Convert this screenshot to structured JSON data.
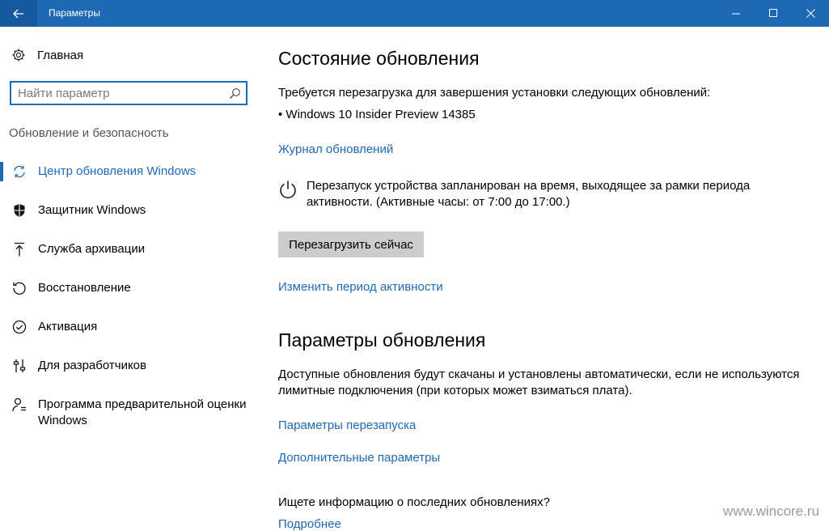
{
  "window": {
    "title": "Параметры",
    "controls": {
      "back": "back-arrow-icon",
      "minimize": "minimize-icon",
      "maximize": "maximize-icon",
      "close": "close-icon"
    },
    "accent_color": "#1e69b4"
  },
  "sidebar": {
    "home_label": "Главная",
    "search_placeholder": "Найти параметр",
    "section_title": "Обновление и безопасность",
    "items": [
      {
        "label": "Центр обновления Windows",
        "icon": "sync-icon",
        "active": true
      },
      {
        "label": "Защитник Windows",
        "icon": "shield-icon"
      },
      {
        "label": "Служба архивации",
        "icon": "backup-arrow-icon"
      },
      {
        "label": "Восстановление",
        "icon": "history-icon"
      },
      {
        "label": "Активация",
        "icon": "check-circle-icon"
      },
      {
        "label": "Для разработчиков",
        "icon": "developer-sliders-icon"
      },
      {
        "label": "Программа предварительной оценки Windows",
        "icon": "insider-person-icon"
      }
    ]
  },
  "main": {
    "status_heading": "Состояние обновления",
    "restart_required_text": "Требуется перезагрузка для завершения установки следующих обновлений:",
    "update_item": "• Windows 10 Insider Preview 14385",
    "update_history_link": "Журнал обновлений",
    "restart_notice": "Перезапуск устройства запланирован на время, выходящее за рамки периода активности. (Активные часы: от 7:00 до 17:00.)",
    "restart_now_button": "Перезагрузить сейчас",
    "change_active_hours_link": "Изменить период активности",
    "settings_heading": "Параметры обновления",
    "auto_update_text": "Доступные обновления будут скачаны и установлены автоматически, если не используются лимитные подключения (при которых может взиматься плата).",
    "restart_options_link": "Параметры перезапуска",
    "advanced_options_link": "Дополнительные параметры",
    "info_question": "Ищете информацию о последних обновлениях?",
    "learn_more_link": "Подробнее"
  },
  "watermark": "www.wincore.ru"
}
